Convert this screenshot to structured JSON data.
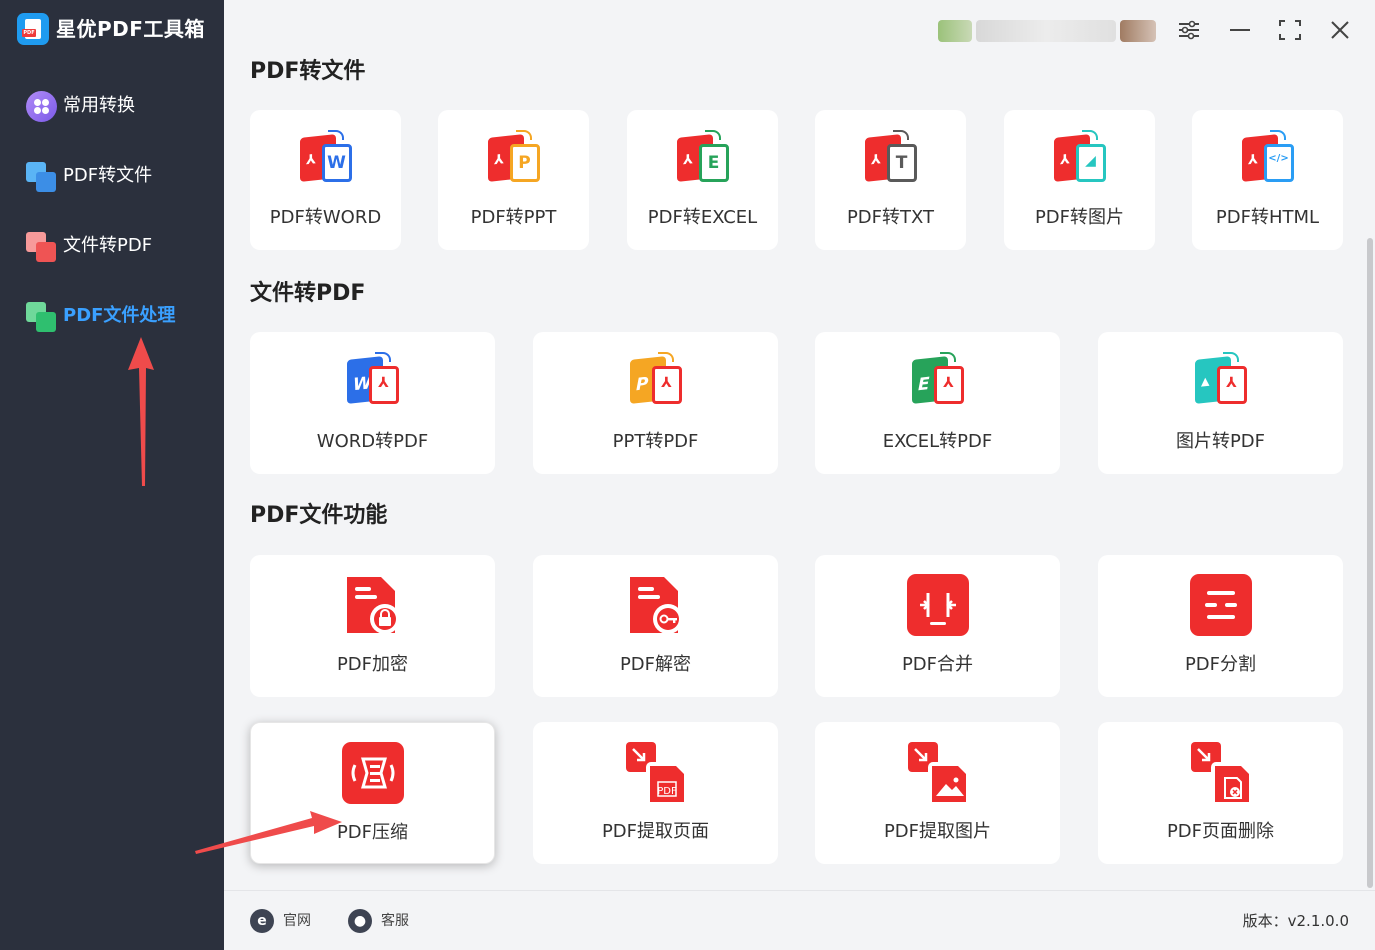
{
  "app": {
    "title": "星优PDF工具箱",
    "logo_tag": "PDF"
  },
  "sidebar": {
    "items": [
      {
        "label": "常用转换",
        "icon": "grid-circle-icon"
      },
      {
        "label": "PDF转文件",
        "icon": "pdf-to-file-icon"
      },
      {
        "label": "文件转PDF",
        "icon": "file-to-pdf-icon"
      },
      {
        "label": "PDF文件处理",
        "icon": "pdf-process-icon",
        "active": true
      }
    ]
  },
  "window": {
    "controls": [
      "settings-icon",
      "minimize-icon",
      "maximize-icon",
      "close-icon"
    ]
  },
  "sections": [
    {
      "title": "PDF转文件",
      "cards": [
        {
          "label": "PDF转WORD",
          "letter": "W",
          "color": "#2c6fe8"
        },
        {
          "label": "PDF转PPT",
          "letter": "P",
          "color": "#f5a623"
        },
        {
          "label": "PDF转EXCEL",
          "letter": "E",
          "color": "#27a35a"
        },
        {
          "label": "PDF转TXT",
          "letter": "T",
          "color": "#5a5a5a"
        },
        {
          "label": "PDF转图片",
          "letter": "",
          "color": "#26c6c0"
        },
        {
          "label": "PDF转HTML",
          "letter": "</>",
          "color": "#2a9df4"
        }
      ]
    },
    {
      "title": "文件转PDF",
      "cards": [
        {
          "label": "WORD转PDF",
          "letter": "W",
          "color": "#2c6fe8"
        },
        {
          "label": "PPT转PDF",
          "letter": "P",
          "color": "#f5a623"
        },
        {
          "label": "EXCEL转PDF",
          "letter": "E",
          "color": "#27a35a"
        },
        {
          "label": "图片转PDF",
          "letter": "",
          "color": "#26c6c0"
        }
      ]
    },
    {
      "title": "PDF文件功能",
      "cards": [
        {
          "label": "PDF加密",
          "icon": "lock-icon"
        },
        {
          "label": "PDF解密",
          "icon": "key-icon"
        },
        {
          "label": "PDF合并",
          "icon": "merge-icon"
        },
        {
          "label": "PDF分割",
          "icon": "split-icon"
        },
        {
          "label": "PDF压缩",
          "icon": "compress-icon",
          "highlighted": true
        },
        {
          "label": "PDF提取页面",
          "icon": "extract-page-icon",
          "sub": "PDF"
        },
        {
          "label": "PDF提取图片",
          "icon": "extract-image-icon"
        },
        {
          "label": "PDF页面删除",
          "icon": "delete-page-icon"
        }
      ]
    }
  ],
  "footer": {
    "website_label": "官网",
    "support_label": "客服",
    "version": "版本：v2.1.0.0"
  },
  "colors": {
    "sidebar_bg": "#2b303d",
    "accent": "#3aa0ff",
    "pdf_red": "#ee2d2d",
    "annotation_arrow": "#ef4b4b"
  }
}
